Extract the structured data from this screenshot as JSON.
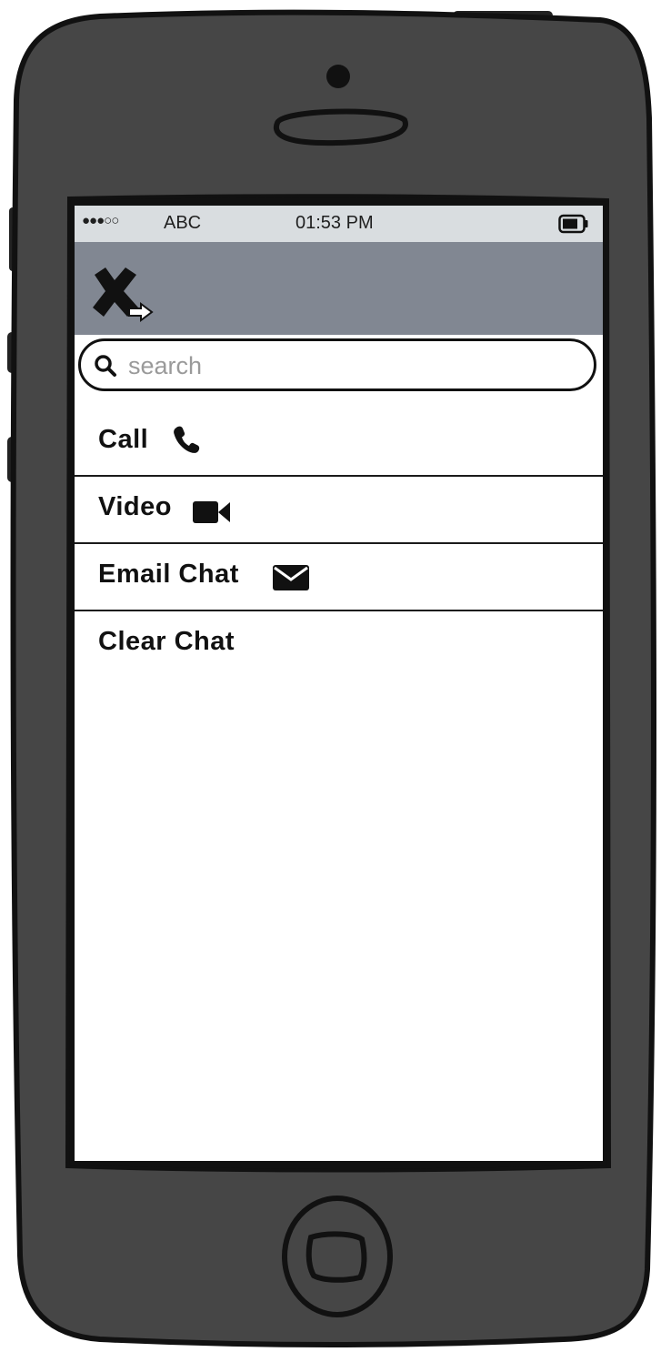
{
  "status_bar": {
    "signal_dots": "●●●○○",
    "carrier": "ABC",
    "time": "01:53 PM",
    "battery_icon": "battery-icon"
  },
  "nav_bar": {
    "close_icon": "close-icon",
    "pointer_icon": "arrow-right-icon"
  },
  "search": {
    "placeholder": "search",
    "value": "",
    "icon": "search-icon"
  },
  "menu": {
    "items": [
      {
        "label": "Call",
        "icon": "phone-icon"
      },
      {
        "label": "Video",
        "icon": "video-camera-icon"
      },
      {
        "label": "Email Chat",
        "icon": "envelope-icon"
      },
      {
        "label": "Clear Chat",
        "icon": ""
      }
    ]
  },
  "colors": {
    "phone_body": "#464646",
    "nav_bar": "#818792",
    "status_bar": "#d9dde0",
    "screen": "#ffffff"
  }
}
